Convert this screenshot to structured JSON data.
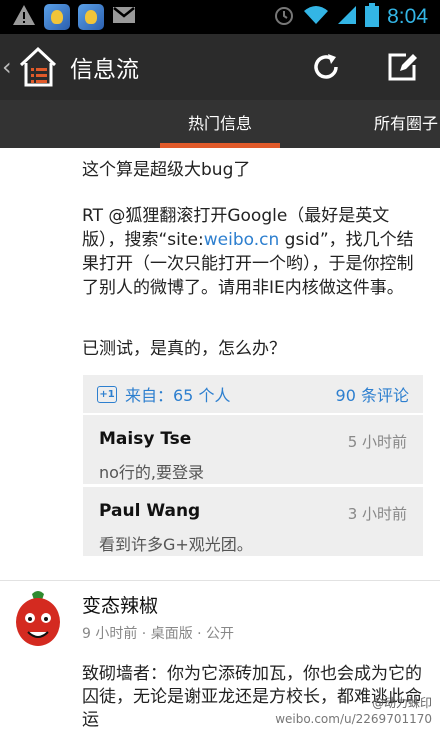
{
  "status_bar": {
    "time": "8:04",
    "icons": [
      "warning-icon",
      "game-icon",
      "game-icon",
      "gmail-icon",
      "alarm-icon",
      "wifi-icon",
      "signal-icon",
      "battery-icon"
    ]
  },
  "action_bar": {
    "back_glyph": "‹",
    "title": "信息流",
    "icons": [
      "home-icon",
      "refresh-icon",
      "compose-icon"
    ]
  },
  "tabs": [
    {
      "label": "热门信息",
      "active": true
    },
    {
      "label": "所有圈子",
      "active": false
    }
  ],
  "post": {
    "line1": "这个算是超级大bug了",
    "p1_a": "RT @狐狸翻滚打开Google（最好是英文版），搜索“site:",
    "p1_link": "weibo.cn",
    "p1_b": " gsid”，找几个结果打开（一次只能打开一个哟），于是你控制了别人的微博了。请用非IE内核做这件事。",
    "line3": "已测试，是真的，怎么办？"
  },
  "comments_box": {
    "plus_label": "+1",
    "from": "来自：65 个人",
    "count": "90 条评论",
    "comments": [
      {
        "name": "Maisy Tse",
        "time": "5 小时前",
        "text": "no行的,要登录"
      },
      {
        "name": "Paul Wang",
        "time": "3 小时前",
        "text": "看到许多G+观光团。"
      }
    ]
  },
  "post2": {
    "user": "变态辣椒",
    "meta": "9 小时前 · 桌面版 · 公开",
    "text": "致砌墙者：你为它添砖加瓦，你也会成为它的囚徒，无论是谢亚龙还是方校长，都难逃此命运"
  },
  "watermark": {
    "brand": "@动力蛛印",
    "url": "weibo.com/u/2269701170"
  },
  "colors": {
    "accent_blue": "#33b5e5",
    "link_blue": "#2d7fcf",
    "tab_indicator": "#e05a2a",
    "actionbar_bg": "#2b2b2b"
  }
}
